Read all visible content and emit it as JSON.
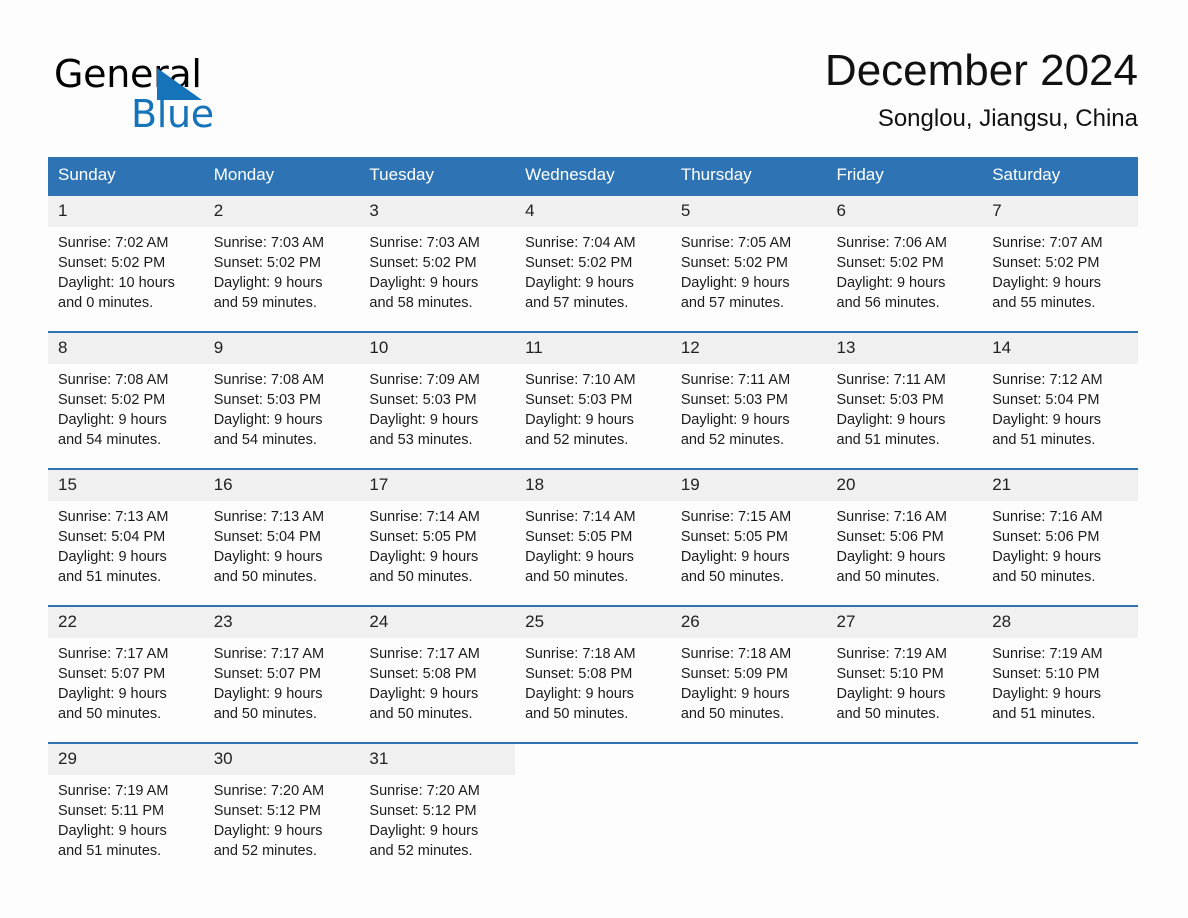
{
  "brand": {
    "name_part1": "General",
    "name_part2": "Blue",
    "accent_color": "#1573b9"
  },
  "header": {
    "title": "December 2024",
    "location": "Songlou, Jiangsu, China"
  },
  "theme": {
    "header_blue": "#2e74b5",
    "daynum_band": "#f0f0f0",
    "page_background": "#fdfdfd"
  },
  "weekday_headers": [
    "Sunday",
    "Monday",
    "Tuesday",
    "Wednesday",
    "Thursday",
    "Friday",
    "Saturday"
  ],
  "weeks": [
    {
      "days": [
        {
          "num": "1",
          "sunrise": "Sunrise: 7:02 AM",
          "sunset": "Sunset: 5:02 PM",
          "daylight_line1": "Daylight: 10 hours",
          "daylight_line2": "and 0 minutes."
        },
        {
          "num": "2",
          "sunrise": "Sunrise: 7:03 AM",
          "sunset": "Sunset: 5:02 PM",
          "daylight_line1": "Daylight: 9 hours",
          "daylight_line2": "and 59 minutes."
        },
        {
          "num": "3",
          "sunrise": "Sunrise: 7:03 AM",
          "sunset": "Sunset: 5:02 PM",
          "daylight_line1": "Daylight: 9 hours",
          "daylight_line2": "and 58 minutes."
        },
        {
          "num": "4",
          "sunrise": "Sunrise: 7:04 AM",
          "sunset": "Sunset: 5:02 PM",
          "daylight_line1": "Daylight: 9 hours",
          "daylight_line2": "and 57 minutes."
        },
        {
          "num": "5",
          "sunrise": "Sunrise: 7:05 AM",
          "sunset": "Sunset: 5:02 PM",
          "daylight_line1": "Daylight: 9 hours",
          "daylight_line2": "and 57 minutes."
        },
        {
          "num": "6",
          "sunrise": "Sunrise: 7:06 AM",
          "sunset": "Sunset: 5:02 PM",
          "daylight_line1": "Daylight: 9 hours",
          "daylight_line2": "and 56 minutes."
        },
        {
          "num": "7",
          "sunrise": "Sunrise: 7:07 AM",
          "sunset": "Sunset: 5:02 PM",
          "daylight_line1": "Daylight: 9 hours",
          "daylight_line2": "and 55 minutes."
        }
      ]
    },
    {
      "days": [
        {
          "num": "8",
          "sunrise": "Sunrise: 7:08 AM",
          "sunset": "Sunset: 5:02 PM",
          "daylight_line1": "Daylight: 9 hours",
          "daylight_line2": "and 54 minutes."
        },
        {
          "num": "9",
          "sunrise": "Sunrise: 7:08 AM",
          "sunset": "Sunset: 5:03 PM",
          "daylight_line1": "Daylight: 9 hours",
          "daylight_line2": "and 54 minutes."
        },
        {
          "num": "10",
          "sunrise": "Sunrise: 7:09 AM",
          "sunset": "Sunset: 5:03 PM",
          "daylight_line1": "Daylight: 9 hours",
          "daylight_line2": "and 53 minutes."
        },
        {
          "num": "11",
          "sunrise": "Sunrise: 7:10 AM",
          "sunset": "Sunset: 5:03 PM",
          "daylight_line1": "Daylight: 9 hours",
          "daylight_line2": "and 52 minutes."
        },
        {
          "num": "12",
          "sunrise": "Sunrise: 7:11 AM",
          "sunset": "Sunset: 5:03 PM",
          "daylight_line1": "Daylight: 9 hours",
          "daylight_line2": "and 52 minutes."
        },
        {
          "num": "13",
          "sunrise": "Sunrise: 7:11 AM",
          "sunset": "Sunset: 5:03 PM",
          "daylight_line1": "Daylight: 9 hours",
          "daylight_line2": "and 51 minutes."
        },
        {
          "num": "14",
          "sunrise": "Sunrise: 7:12 AM",
          "sunset": "Sunset: 5:04 PM",
          "daylight_line1": "Daylight: 9 hours",
          "daylight_line2": "and 51 minutes."
        }
      ]
    },
    {
      "days": [
        {
          "num": "15",
          "sunrise": "Sunrise: 7:13 AM",
          "sunset": "Sunset: 5:04 PM",
          "daylight_line1": "Daylight: 9 hours",
          "daylight_line2": "and 51 minutes."
        },
        {
          "num": "16",
          "sunrise": "Sunrise: 7:13 AM",
          "sunset": "Sunset: 5:04 PM",
          "daylight_line1": "Daylight: 9 hours",
          "daylight_line2": "and 50 minutes."
        },
        {
          "num": "17",
          "sunrise": "Sunrise: 7:14 AM",
          "sunset": "Sunset: 5:05 PM",
          "daylight_line1": "Daylight: 9 hours",
          "daylight_line2": "and 50 minutes."
        },
        {
          "num": "18",
          "sunrise": "Sunrise: 7:14 AM",
          "sunset": "Sunset: 5:05 PM",
          "daylight_line1": "Daylight: 9 hours",
          "daylight_line2": "and 50 minutes."
        },
        {
          "num": "19",
          "sunrise": "Sunrise: 7:15 AM",
          "sunset": "Sunset: 5:05 PM",
          "daylight_line1": "Daylight: 9 hours",
          "daylight_line2": "and 50 minutes."
        },
        {
          "num": "20",
          "sunrise": "Sunrise: 7:16 AM",
          "sunset": "Sunset: 5:06 PM",
          "daylight_line1": "Daylight: 9 hours",
          "daylight_line2": "and 50 minutes."
        },
        {
          "num": "21",
          "sunrise": "Sunrise: 7:16 AM",
          "sunset": "Sunset: 5:06 PM",
          "daylight_line1": "Daylight: 9 hours",
          "daylight_line2": "and 50 minutes."
        }
      ]
    },
    {
      "days": [
        {
          "num": "22",
          "sunrise": "Sunrise: 7:17 AM",
          "sunset": "Sunset: 5:07 PM",
          "daylight_line1": "Daylight: 9 hours",
          "daylight_line2": "and 50 minutes."
        },
        {
          "num": "23",
          "sunrise": "Sunrise: 7:17 AM",
          "sunset": "Sunset: 5:07 PM",
          "daylight_line1": "Daylight: 9 hours",
          "daylight_line2": "and 50 minutes."
        },
        {
          "num": "24",
          "sunrise": "Sunrise: 7:17 AM",
          "sunset": "Sunset: 5:08 PM",
          "daylight_line1": "Daylight: 9 hours",
          "daylight_line2": "and 50 minutes."
        },
        {
          "num": "25",
          "sunrise": "Sunrise: 7:18 AM",
          "sunset": "Sunset: 5:08 PM",
          "daylight_line1": "Daylight: 9 hours",
          "daylight_line2": "and 50 minutes."
        },
        {
          "num": "26",
          "sunrise": "Sunrise: 7:18 AM",
          "sunset": "Sunset: 5:09 PM",
          "daylight_line1": "Daylight: 9 hours",
          "daylight_line2": "and 50 minutes."
        },
        {
          "num": "27",
          "sunrise": "Sunrise: 7:19 AM",
          "sunset": "Sunset: 5:10 PM",
          "daylight_line1": "Daylight: 9 hours",
          "daylight_line2": "and 50 minutes."
        },
        {
          "num": "28",
          "sunrise": "Sunrise: 7:19 AM",
          "sunset": "Sunset: 5:10 PM",
          "daylight_line1": "Daylight: 9 hours",
          "daylight_line2": "and 51 minutes."
        }
      ]
    },
    {
      "days": [
        {
          "num": "29",
          "sunrise": "Sunrise: 7:19 AM",
          "sunset": "Sunset: 5:11 PM",
          "daylight_line1": "Daylight: 9 hours",
          "daylight_line2": "and 51 minutes."
        },
        {
          "num": "30",
          "sunrise": "Sunrise: 7:20 AM",
          "sunset": "Sunset: 5:12 PM",
          "daylight_line1": "Daylight: 9 hours",
          "daylight_line2": "and 52 minutes."
        },
        {
          "num": "31",
          "sunrise": "Sunrise: 7:20 AM",
          "sunset": "Sunset: 5:12 PM",
          "daylight_line1": "Daylight: 9 hours",
          "daylight_line2": "and 52 minutes."
        },
        {
          "num": "",
          "sunrise": "",
          "sunset": "",
          "daylight_line1": "",
          "daylight_line2": ""
        },
        {
          "num": "",
          "sunrise": "",
          "sunset": "",
          "daylight_line1": "",
          "daylight_line2": ""
        },
        {
          "num": "",
          "sunrise": "",
          "sunset": "",
          "daylight_line1": "",
          "daylight_line2": ""
        },
        {
          "num": "",
          "sunrise": "",
          "sunset": "",
          "daylight_line1": "",
          "daylight_line2": ""
        }
      ]
    }
  ]
}
